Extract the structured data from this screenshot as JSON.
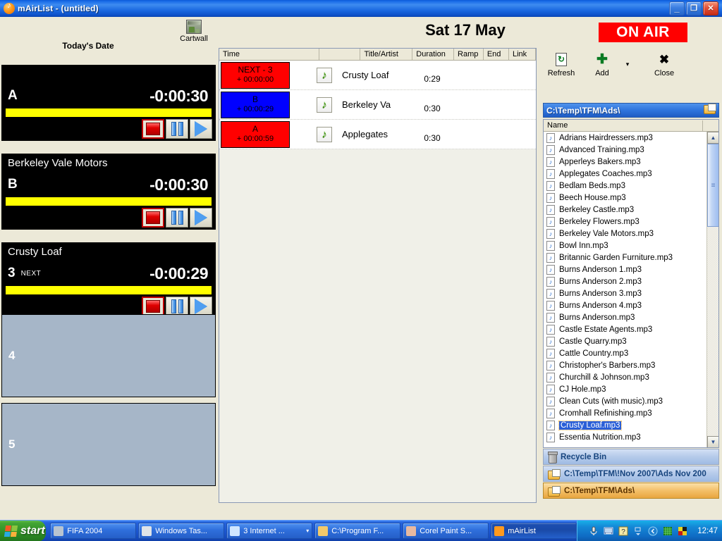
{
  "window": {
    "title": "mAirList - (untitled)",
    "icon": "mairlist-orange-icon",
    "minimize": "_",
    "restore": "❐",
    "close": "✕"
  },
  "header": {
    "todays_date_label": "Today's Date",
    "cartwall_label": "Cartwall",
    "date": "Sat 17 May",
    "on_air": "ON AIR"
  },
  "players": [
    {
      "id": "A",
      "title": "",
      "time": "-0:00:30",
      "next": "",
      "state": "loaded"
    },
    {
      "id": "B",
      "title": "Berkeley Vale Motors",
      "time": "-0:00:30",
      "next": "",
      "state": "loaded"
    },
    {
      "id": "3",
      "title": "Crusty Loaf",
      "time": "-0:00:29",
      "next": "NEXT",
      "state": "next"
    }
  ],
  "empty_slots": [
    {
      "id": "4"
    },
    {
      "id": "5"
    }
  ],
  "player_controls": {
    "stop": "stop-button",
    "pause": "pause-button",
    "play": "play-button"
  },
  "playlist": {
    "columns": [
      "Time",
      "",
      "Title/Artist",
      "Duration",
      "Ramp",
      "End",
      "Link"
    ],
    "rows": [
      {
        "badge_line1": "NEXT - 3",
        "badge_line2": "+ 00:00:00",
        "badge_color": "#ff0000",
        "title": "Crusty Loaf",
        "duration": "0:29",
        "ramp": "",
        "end": "",
        "link": ""
      },
      {
        "badge_line1": "B",
        "badge_line2": "+ 00:00:29",
        "badge_color": "#0000ff",
        "title": "Berkeley Va",
        "duration": "0:30",
        "ramp": "",
        "end": "",
        "link": ""
      },
      {
        "badge_line1": "A",
        "badge_line2": "+ 00:00:59",
        "badge_color": "#ff0000",
        "title": "Applegates",
        "duration": "0:30",
        "ramp": "",
        "end": "",
        "link": ""
      }
    ]
  },
  "toolbar": {
    "refresh_label": "Refresh",
    "add_label": "Add",
    "add_dropdown": "▾",
    "close_label": "Close"
  },
  "browser": {
    "path": "C:\\Temp\\TFM\\Ads\\",
    "list_header": "Name",
    "files": [
      {
        "name": "Adrians Hairdressers.mp3",
        "selected": false
      },
      {
        "name": "Advanced Training.mp3",
        "selected": false
      },
      {
        "name": "Apperleys Bakers.mp3",
        "selected": false
      },
      {
        "name": "Applegates Coaches.mp3",
        "selected": false
      },
      {
        "name": "Bedlam Beds.mp3",
        "selected": false
      },
      {
        "name": "Beech House.mp3",
        "selected": false
      },
      {
        "name": "Berkeley Castle.mp3",
        "selected": false
      },
      {
        "name": "Berkeley Flowers.mp3",
        "selected": false
      },
      {
        "name": "Berkeley Vale Motors.mp3",
        "selected": false
      },
      {
        "name": "Bowl Inn.mp3",
        "selected": false
      },
      {
        "name": "Britannic Garden Furniture.mp3",
        "selected": false
      },
      {
        "name": "Burns Anderson 1.mp3",
        "selected": false
      },
      {
        "name": "Burns Anderson 2.mp3",
        "selected": false
      },
      {
        "name": "Burns Anderson 3.mp3",
        "selected": false
      },
      {
        "name": "Burns Anderson 4.mp3",
        "selected": false
      },
      {
        "name": "Burns Anderson.mp3",
        "selected": false
      },
      {
        "name": "Castle Estate Agents.mp3",
        "selected": false
      },
      {
        "name": "Castle Quarry.mp3",
        "selected": false
      },
      {
        "name": "Cattle Country.mp3",
        "selected": false
      },
      {
        "name": "Christopher's Barbers.mp3",
        "selected": false
      },
      {
        "name": "Churchill & Johnson.mp3",
        "selected": false
      },
      {
        "name": "CJ Hole.mp3",
        "selected": false
      },
      {
        "name": "Clean Cuts (with music).mp3",
        "selected": false
      },
      {
        "name": "Cromhall Refinishing.mp3",
        "selected": false
      },
      {
        "name": "Crusty Loaf.mp3",
        "selected": true
      },
      {
        "name": "Essentia Nutrition.mp3",
        "selected": false
      }
    ],
    "folder_bars": [
      {
        "label": "Recycle Bin",
        "icon": "recycle-bin-icon",
        "active": false
      },
      {
        "label": "C:\\Temp\\TFM\\!Nov 2007\\Ads Nov 200",
        "icon": "folder-icon",
        "active": false
      },
      {
        "label": "C:\\Temp\\TFM\\Ads\\",
        "icon": "folder-icon",
        "active": true
      }
    ],
    "scroll": {
      "up": "▲",
      "down": "▼"
    }
  },
  "taskbar": {
    "start_label": "start",
    "items": [
      {
        "label": "FIFA 2004",
        "icon_color": "#b8c4d0",
        "active": false,
        "dropdown": ""
      },
      {
        "label": "Windows Tas...",
        "icon_color": "#dfe4e8",
        "active": false,
        "dropdown": ""
      },
      {
        "label": "3 Internet ...",
        "icon_color": "#cfe6ff",
        "active": false,
        "dropdown": "▾"
      },
      {
        "label": "C:\\Program F...",
        "icon_color": "#f3c96a",
        "active": false,
        "dropdown": ""
      },
      {
        "label": "Corel Paint S...",
        "icon_color": "#e8b9a0",
        "active": false,
        "dropdown": ""
      },
      {
        "label": "mAirList",
        "icon_color": "#ff9a1e",
        "active": true,
        "dropdown": ""
      }
    ],
    "tray_icons": [
      "microphone-icon",
      "network-icon",
      "help-icon",
      "arrow-icon"
    ],
    "clock": "12:47"
  },
  "colors": {
    "on_air": "#ff0000",
    "player_bg": "#000000",
    "progress_bar": "#ffff00",
    "empty_slot": "#a6b6c8",
    "badge_red": "#ff0000",
    "badge_blue": "#0000ff",
    "selection": "#2a5fd8",
    "active_folder": "#f4c06a"
  }
}
